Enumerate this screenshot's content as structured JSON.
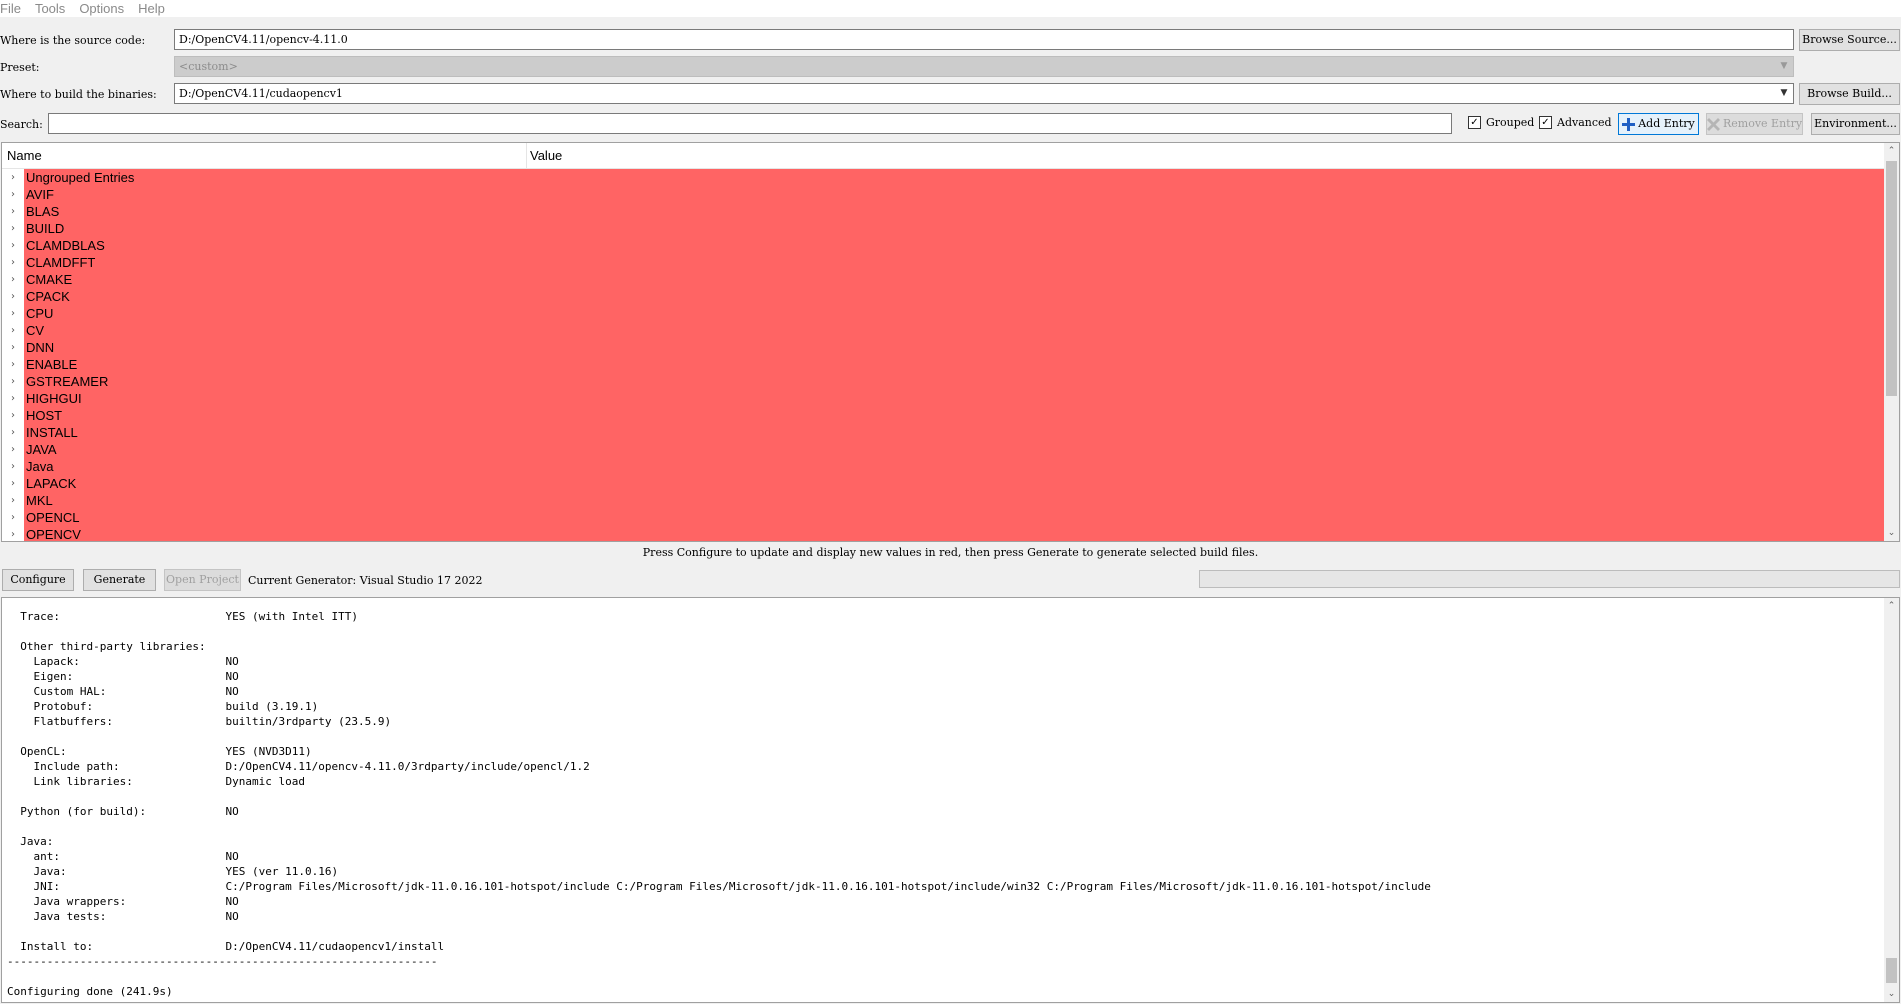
{
  "menu": [
    "File",
    "Tools",
    "Options",
    "Help"
  ],
  "source": {
    "label": "Where is the source code:",
    "value": "D:/OpenCV4.11/opencv-4.11.0",
    "browse": "Browse Source..."
  },
  "preset": {
    "label": "Preset:",
    "value": "<custom>"
  },
  "build": {
    "label": "Where to build the binaries:",
    "value": "D:/OpenCV4.11/cudaopencv1",
    "browse": "Browse Build..."
  },
  "search": {
    "label": "Search:",
    "value": ""
  },
  "options": {
    "grouped": "Grouped",
    "advanced": "Advanced",
    "grouped_checked": true,
    "advanced_checked": true
  },
  "actions": {
    "add_entry": "Add Entry",
    "remove_entry": "Remove Entry",
    "environment": "Environment..."
  },
  "tree": {
    "col_name": "Name",
    "col_value": "Value",
    "highlight_color": "#ff6464",
    "rows": [
      "Ungrouped Entries",
      "AVIF",
      "BLAS",
      "BUILD",
      "CLAMDBLAS",
      "CLAMDFFT",
      "CMAKE",
      "CPACK",
      "CPU",
      "CV",
      "DNN",
      "ENABLE",
      "GSTREAMER",
      "HIGHGUI",
      "HOST",
      "INSTALL",
      "JAVA",
      "Java",
      "LAPACK",
      "MKL",
      "OPENCL",
      "OPENCV"
    ]
  },
  "status_message": "Press Configure to update and display new values in red,  then press Generate to generate selected build files.",
  "bottom": {
    "configure": "Configure",
    "generate": "Generate",
    "open_project": "Open Project",
    "generator": "Current Generator: Visual Studio 17 2022"
  },
  "output": [
    "  Trace:                         YES (with Intel ITT)",
    "",
    "  Other third-party libraries:",
    "    Lapack:                      NO",
    "    Eigen:                       NO",
    "    Custom HAL:                  NO",
    "    Protobuf:                    build (3.19.1)",
    "    Flatbuffers:                 builtin/3rdparty (23.5.9)",
    "",
    "  OpenCL:                        YES (NVD3D11)",
    "    Include path:                D:/OpenCV4.11/opencv-4.11.0/3rdparty/include/opencl/1.2",
    "    Link libraries:              Dynamic load",
    "",
    "  Python (for build):            NO",
    "",
    "  Java:",
    "    ant:                         NO",
    "    Java:                        YES (ver 11.0.16)",
    "    JNI:                         C:/Program Files/Microsoft/jdk-11.0.16.101-hotspot/include C:/Program Files/Microsoft/jdk-11.0.16.101-hotspot/include/win32 C:/Program Files/Microsoft/jdk-11.0.16.101-hotspot/include",
    "    Java wrappers:               NO",
    "    Java tests:                  NO",
    "",
    "  Install to:                    D:/OpenCV4.11/cudaopencv1/install",
    "-----------------------------------------------------------------",
    "",
    "Configuring done (241.9s)"
  ]
}
